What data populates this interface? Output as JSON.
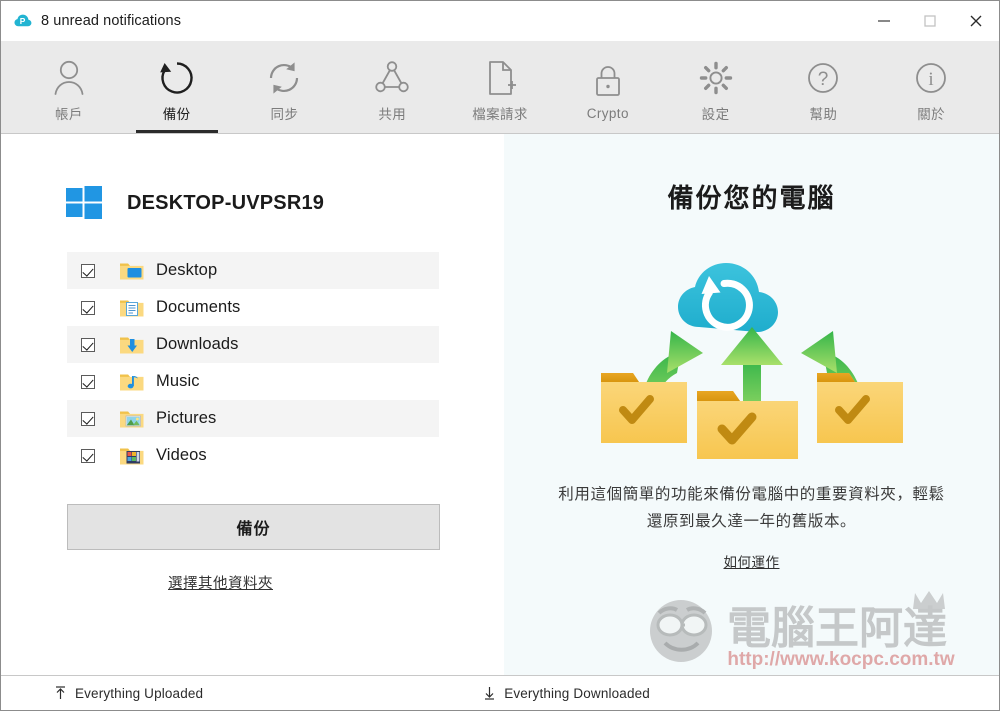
{
  "titlebar": {
    "app_icon": "pcloud-cloud-icon",
    "title": "8 unread notifications",
    "minimize_label": "minimize",
    "maximize_label": "maximize",
    "close_label": "close"
  },
  "toolbar": {
    "items": [
      {
        "label": "帳戶",
        "icon": "user-icon",
        "active": false
      },
      {
        "label": "備份",
        "icon": "backup-rotate-icon",
        "active": true
      },
      {
        "label": "同步",
        "icon": "sync-icon",
        "active": false
      },
      {
        "label": "共用",
        "icon": "share-nodes-icon",
        "active": false
      },
      {
        "label": "檔案請求",
        "icon": "file-plus-icon",
        "active": false
      },
      {
        "label": "Crypto",
        "icon": "lock-icon",
        "active": false
      },
      {
        "label": "設定",
        "icon": "gear-icon",
        "active": false
      },
      {
        "label": "幫助",
        "icon": "question-circle-icon",
        "active": false
      },
      {
        "label": "關於",
        "icon": "info-circle-icon",
        "active": false
      }
    ]
  },
  "left_panel": {
    "device_icon": "windows-logo-icon",
    "device_name": "DESKTOP-UVPSR19",
    "folders": [
      {
        "label": "Desktop",
        "icon": "folder-desktop-icon",
        "checked": true
      },
      {
        "label": "Documents",
        "icon": "folder-documents-icon",
        "checked": true
      },
      {
        "label": "Downloads",
        "icon": "folder-downloads-icon",
        "checked": true
      },
      {
        "label": "Music",
        "icon": "folder-music-icon",
        "checked": true
      },
      {
        "label": "Pictures",
        "icon": "folder-pictures-icon",
        "checked": true
      },
      {
        "label": "Videos",
        "icon": "folder-videos-icon",
        "checked": true
      }
    ],
    "backup_button": "備份",
    "choose_other_link": "選擇其他資料夾"
  },
  "right_panel": {
    "title": "備份您的電腦",
    "illustration": "cloud-backup-folders-illustration",
    "description": "利用這個簡單的功能來備份電腦中的重要資料夾，輕鬆還原到最久達一年的舊版本。",
    "how_it_works_link": "如何運作",
    "watermark": {
      "brand": "電腦王阿達",
      "url": "http://www.kocpc.com.tw"
    }
  },
  "statusbar": {
    "upload": {
      "icon": "upload-arrow-icon",
      "text": "Everything Uploaded"
    },
    "download": {
      "icon": "download-arrow-icon",
      "text": "Everything Downloaded"
    }
  },
  "colors": {
    "accent_cyan": "#23b5d3",
    "toolbar_bg": "#eaeaea",
    "right_panel_bg": "#f4fafb",
    "folder_yellow": "#f5c75a",
    "arrow_green": "#6cc24a",
    "windows_blue": "#2196e3",
    "watermark_red": "#d03a3a"
  }
}
